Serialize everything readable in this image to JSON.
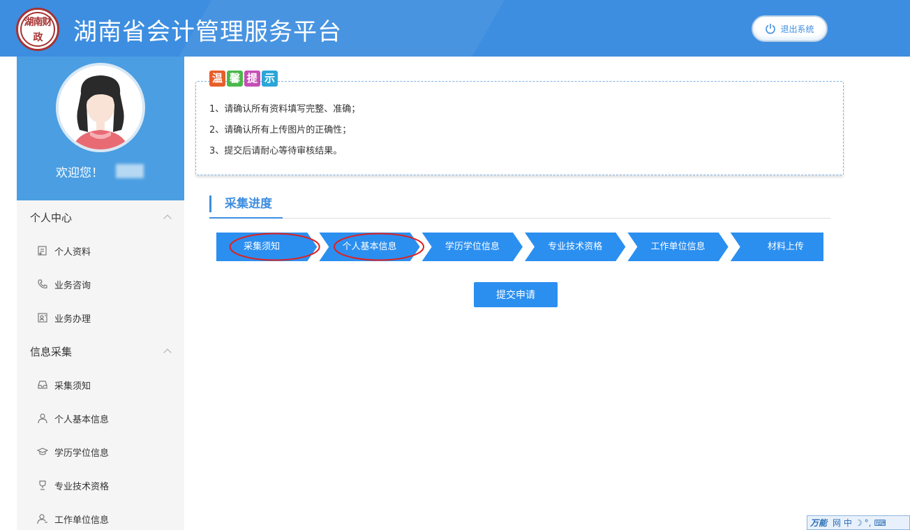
{
  "header": {
    "logo_text": "湖南财政",
    "title": "湖南省会计管理服务平台",
    "logout_label": "退出系统"
  },
  "sidebar": {
    "welcome": "欢迎您！",
    "groups": [
      {
        "title": "个人中心",
        "items": [
          {
            "label": "个人资料"
          },
          {
            "label": "业务咨询"
          },
          {
            "label": "业务办理"
          }
        ]
      },
      {
        "title": "信息采集",
        "items": [
          {
            "label": "采集须知"
          },
          {
            "label": "个人基本信息"
          },
          {
            "label": "学历学位信息"
          },
          {
            "label": "专业技术资格"
          },
          {
            "label": "工作单位信息"
          }
        ]
      }
    ]
  },
  "notice": {
    "badge": [
      "温",
      "馨",
      "提",
      "示"
    ],
    "badge_colors": [
      "#e85d2a",
      "#4bb84b",
      "#c54fb6",
      "#2ba6d8"
    ],
    "lines": [
      "1、请确认所有资料填写完整、准确；",
      "2、请确认所有上传图片的正确性；",
      "3、提交后请耐心等待审核结果。"
    ]
  },
  "progress": {
    "title": "采集进度",
    "steps": [
      "采集须知",
      "个人基本信息",
      "学历学位信息",
      "专业技术资格",
      "工作单位信息",
      "材料上传"
    ],
    "color": "#2b8ff0",
    "highlight_color": "#e0201e"
  },
  "submit_label": "提交申请",
  "ime": {
    "label": "万能",
    "mode": "网 中"
  }
}
